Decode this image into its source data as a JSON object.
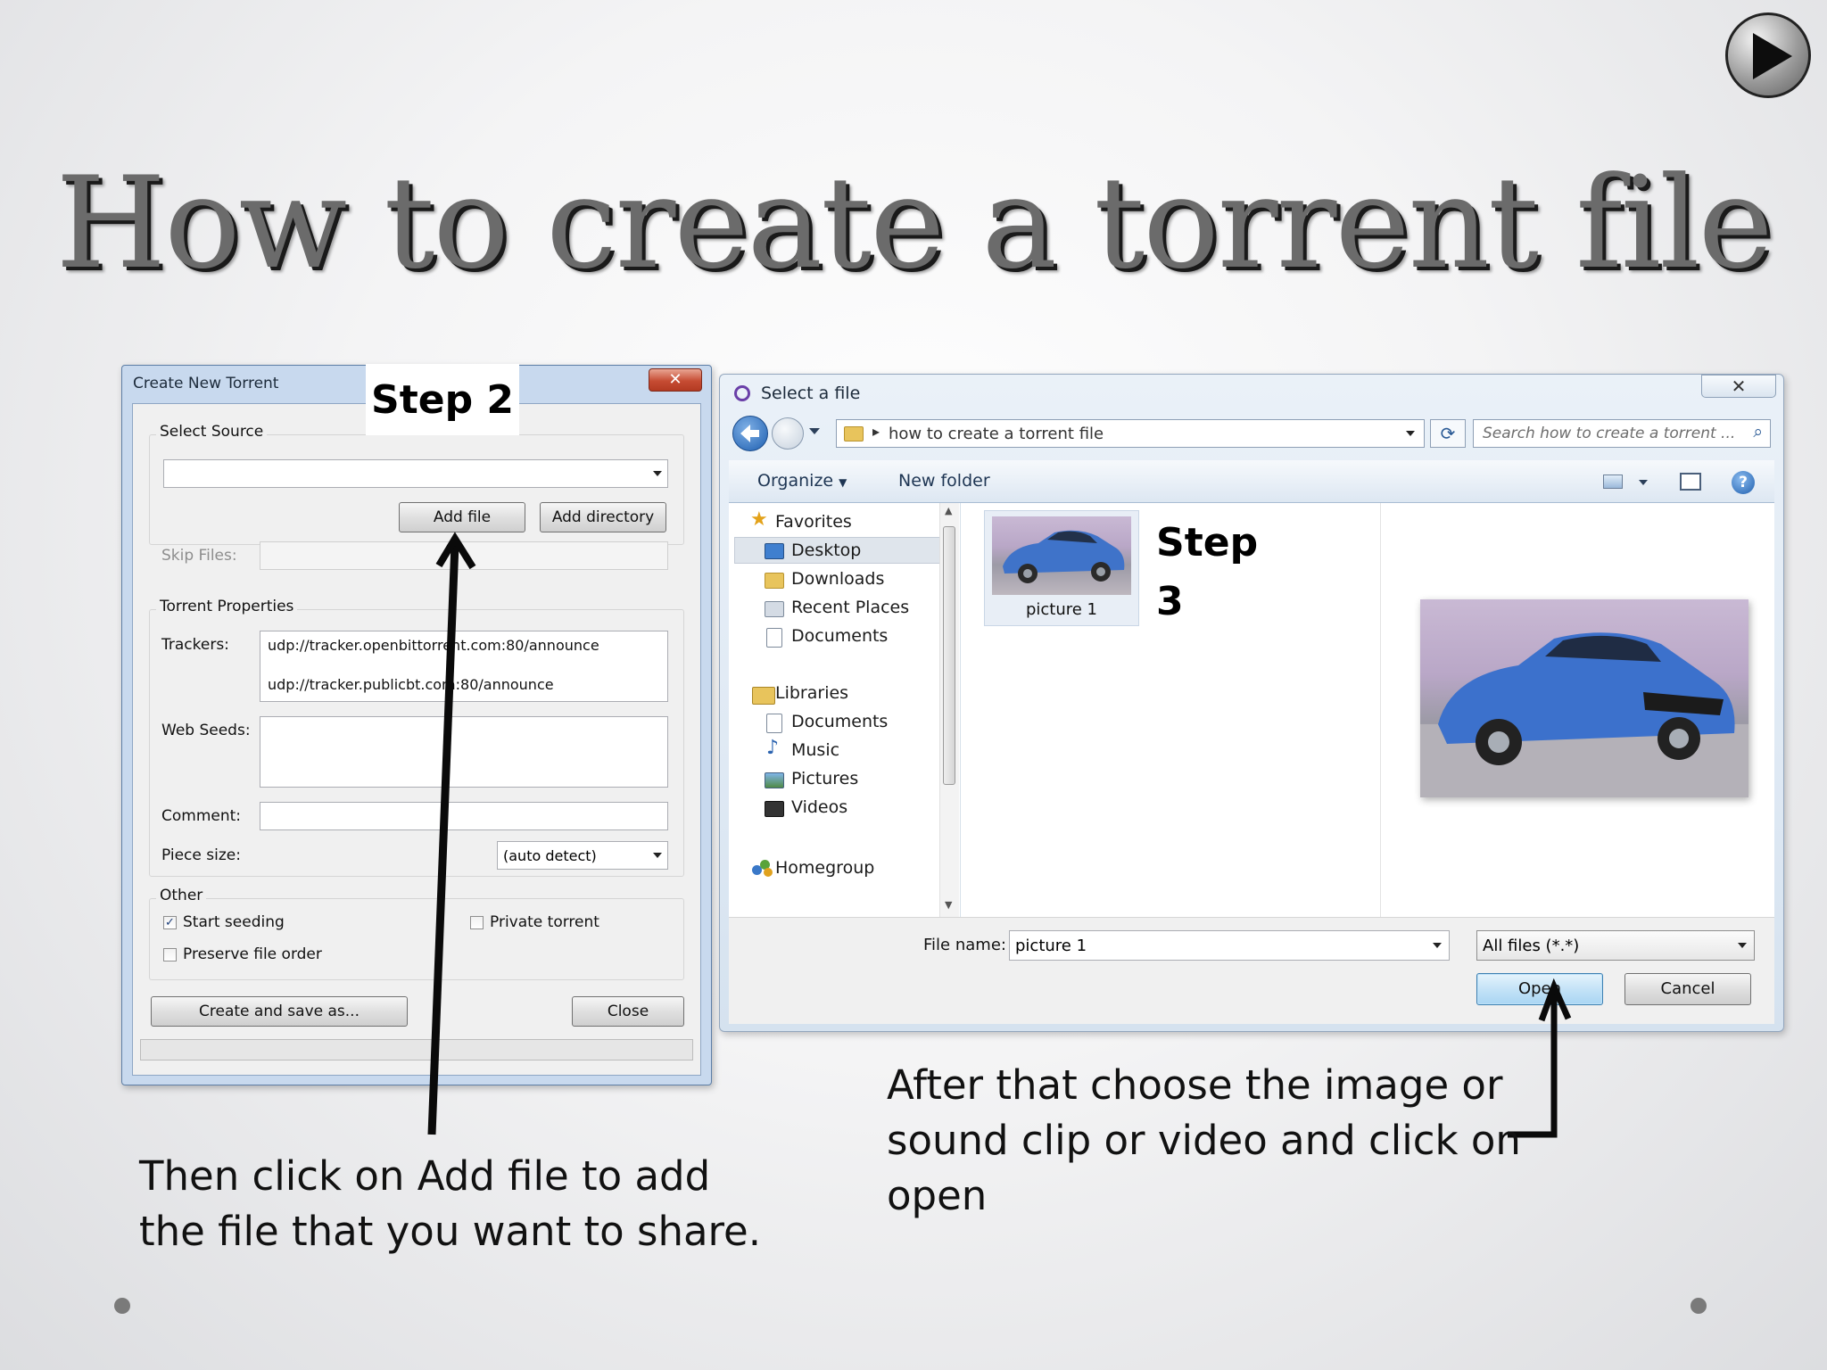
{
  "slide": {
    "title": "How to create a torrent file",
    "caption_step2": "Then click on Add file to add the file that you want to share.",
    "caption_step2_lines": [
      "Then click on Add file to add",
      "the file that you want to share."
    ],
    "caption_step3_lines": [
      "After that choose the image or",
      "sound clip or video and click on",
      "open"
    ],
    "step2_label": "Step 2",
    "step3_label": "Step 3"
  },
  "create_torrent": {
    "window_title": "Create New Torrent",
    "select_source_group": "Select Source",
    "source_value": "",
    "add_file_button": "Add file",
    "add_directory_button": "Add directory",
    "skip_files_label": "Skip Files:",
    "torrent_properties_group": "Torrent Properties",
    "trackers_label": "Trackers:",
    "trackers": [
      "udp://tracker.openbittorrent.com:80/announce",
      "udp://tracker.publicbt.com:80/announce"
    ],
    "web_seeds_label": "Web Seeds:",
    "comment_label": "Comment:",
    "piece_size_label": "Piece size:",
    "piece_size_value": "(auto detect)",
    "other_group": "Other",
    "start_seeding_label": "Start seeding",
    "start_seeding_checked": true,
    "private_torrent_label": "Private torrent",
    "preserve_order_label": "Preserve file order",
    "create_save_button": "Create and save as...",
    "close_button": "Close"
  },
  "select_file": {
    "window_title": "Select a file",
    "breadcrumb": "how to create a torrent file",
    "search_placeholder": "Search how to create a torrent ...",
    "toolbar": {
      "organize": "Organize",
      "new_folder": "New folder"
    },
    "nav": {
      "favorites": "Favorites",
      "favorites_items": [
        "Desktop",
        "Downloads",
        "Recent Places"
      ],
      "documents_top": "Documents",
      "libraries": "Libraries",
      "library_items": [
        "Documents",
        "Music",
        "Pictures",
        "Videos"
      ],
      "homegroup": "Homegroup"
    },
    "file_item": "picture 1",
    "file_name_label": "File name:",
    "file_name_value": "picture 1",
    "file_type_value": "All files (*.*)",
    "open_button": "Open",
    "cancel_button": "Cancel"
  },
  "colors": {
    "accent": "#2b6cb8",
    "annotation": "#111111"
  }
}
